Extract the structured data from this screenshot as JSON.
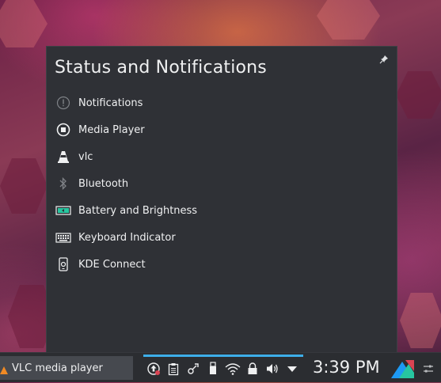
{
  "popup": {
    "title": "Status and Notifications",
    "pin_icon": "pin-icon",
    "items": [
      {
        "label": "Notifications",
        "icon": "notifications-icon"
      },
      {
        "label": "Media Player",
        "icon": "media-player-icon"
      },
      {
        "label": "vlc",
        "icon": "vlc-cone-icon"
      },
      {
        "label": "Bluetooth",
        "icon": "bluetooth-icon"
      },
      {
        "label": "Battery and Brightness",
        "icon": "battery-icon"
      },
      {
        "label": "Keyboard Indicator",
        "icon": "keyboard-icon"
      },
      {
        "label": "KDE Connect",
        "icon": "kde-connect-icon"
      }
    ]
  },
  "taskbar": {
    "task_label": "VLC media player",
    "clock": "3:39 PM",
    "tray_icons": [
      "updates-icon",
      "clipboard-icon",
      "kde-connect-tray-icon",
      "usb-device-icon",
      "wifi-icon",
      "lock-icon",
      "volume-icon",
      "expand-tray-icon"
    ]
  },
  "colors": {
    "accent": "#3daee9",
    "popup_bg": "#2f3136",
    "taskbar_bg": "#2b2d31",
    "text": "#eff0f1"
  }
}
